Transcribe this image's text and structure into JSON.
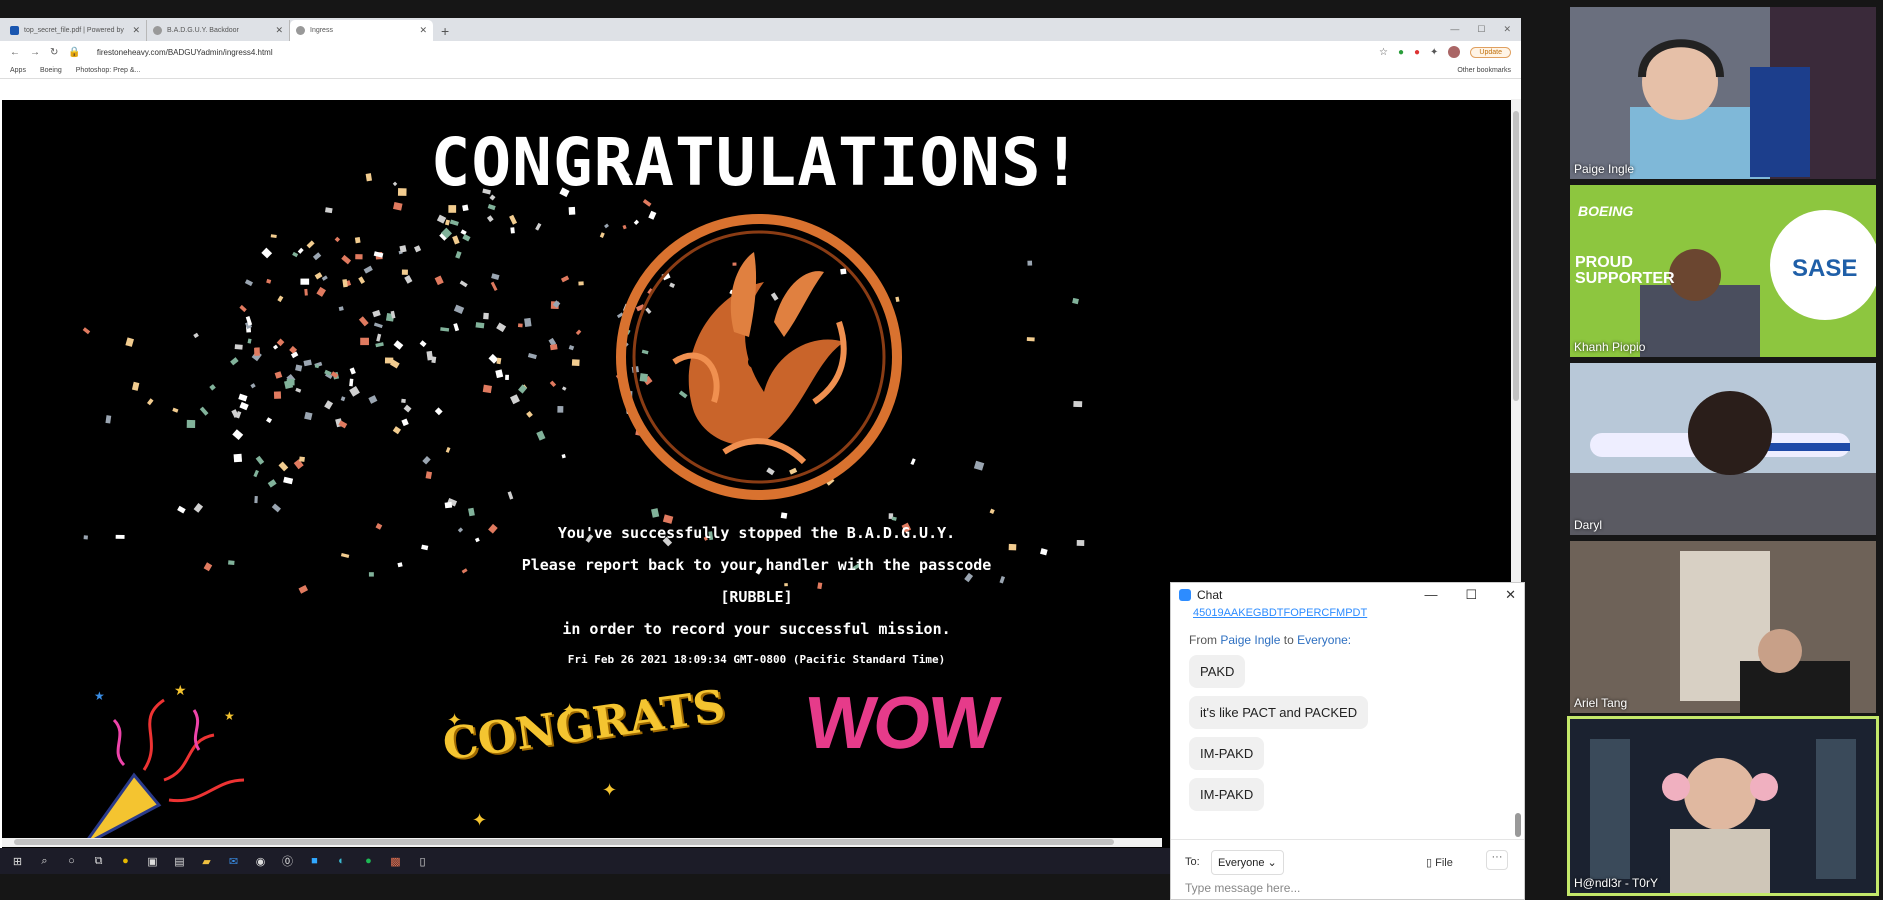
{
  "browser": {
    "tabs": [
      {
        "label": "top_secret_file.pdf | Powered by"
      },
      {
        "label": "B.A.D.G.U.Y. Backdoor"
      },
      {
        "label": "Ingress"
      }
    ],
    "url": "firestoneheavy.com/BADGUYadmin/ingress4.html",
    "update_label": "Update",
    "bookmarks": [
      "Apps",
      "Boeing",
      "Photoshop: Prep &..."
    ],
    "other_bookmarks": "Other bookmarks"
  },
  "page": {
    "heading": "CONGRATULATIONS!",
    "line1": "You've successfully stopped the B.A.D.G.U.Y.",
    "line2": "Please report back to your handler with the passcode",
    "passcode": "[RUBBLE]",
    "line3": "in order to record your successful mission.",
    "timestamp": "Fri Feb 26 2021 18:09:34 GMT-0800 (Pacific Standard Time)",
    "sticker_congrats": "CONGRATS",
    "sticker_wow": "WOW",
    "accent_orange": "#d9722f"
  },
  "chat": {
    "title": "Chat",
    "link_partial": "45019AAKEGBDTFOPERCFMPDT",
    "from_label": "From",
    "sender": "Paige Ingle",
    "to_word": "to",
    "recipient": "Everyone:",
    "messages": [
      "PAKD",
      "it's like PACT and PACKED",
      "IM-PAKD",
      "IM-PAKD"
    ],
    "to_label": "To:",
    "to_value": "Everyone",
    "file_label": "File",
    "placeholder": "Type message here..."
  },
  "participants": [
    {
      "name": "Paige Ingle"
    },
    {
      "name": "Khanh Piopio",
      "banner_left": "PROUD SUPPORTER",
      "brand": "BOEING",
      "badge": "SASE"
    },
    {
      "name": "Daryl"
    },
    {
      "name": "Ariel Tang"
    },
    {
      "name": "H@ndl3r - T0rY"
    }
  ]
}
